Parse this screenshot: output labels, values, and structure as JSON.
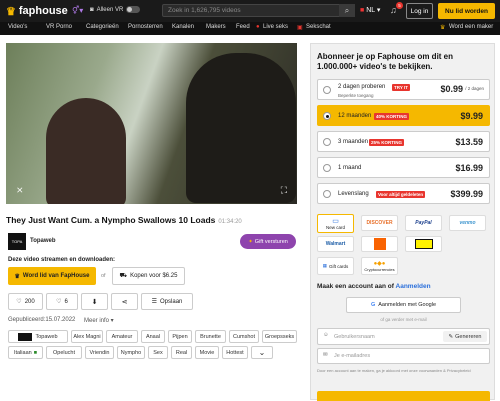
{
  "header": {
    "logo_text": "faphouse",
    "vr_toggle_label": "Alleen VR",
    "search_placeholder": "Zoek in 1,626,795 videos",
    "language": "NL",
    "notifications_count": "5",
    "login_label": "Log in",
    "join_label": "Nu lid worden"
  },
  "nav": {
    "items": [
      "Video's",
      "VR Porno",
      "Categorieën",
      "Pornosterren",
      "Kanalen",
      "Makers",
      "Feed",
      "Live seks",
      "Sekschat"
    ],
    "maker_label": "Word een maker"
  },
  "video": {
    "title": "They Just Want Cum. a Nympho Swallows 10 Loads",
    "duration": "01:34:20",
    "channel_name": "Topaweb",
    "gift_label": "Gift versturen",
    "stream_label": "Deze video streamen en downloaden:",
    "member_button": "Word lid van FapHouse",
    "or_label": "of",
    "buy_button": "Kopen voor $6.25",
    "likes": "200",
    "dislikes": "6",
    "save_label": "Opslaan",
    "published": "Gepubliceerd:15.07.2022",
    "more_info": "Meer info"
  },
  "tags": [
    "Topaweb",
    "Alex Magni",
    "Amateur",
    "Anaal",
    "Pijpen",
    "Brunette",
    "Cumshot",
    "Groepsseks",
    "Italiaan",
    "Opelucht",
    "Vriendin",
    "Nympho",
    "Sex",
    "Real",
    "Movie",
    "Hottest"
  ],
  "subscribe": {
    "heading": "Abonneer je op Faphouse om dit en 1.000.000+ video's te bekijken.",
    "plans": [
      {
        "label": "2 dagen proberen",
        "sub": "Beperkte toegang",
        "badge": "TRY IT",
        "price": "$0.99",
        "price_suffix": "/ 2 dagen"
      },
      {
        "label": "12 maanden",
        "sub": "",
        "badge": "40% KORTING",
        "price": "$9.99"
      },
      {
        "label": "3 maanden",
        "sub": "",
        "badge": "25% KORTING",
        "price": "$13.59"
      },
      {
        "label": "1 maand",
        "sub": "",
        "badge": "",
        "price": "$16.99"
      },
      {
        "label": "Levenslang",
        "sub": "",
        "badge": "Voor altijd geldeleten",
        "price": "$399.99"
      }
    ],
    "payments": [
      "New card",
      "DISCOVER",
      "PayPal",
      "venmo",
      "Walmart",
      "Home Depot",
      "Best Buy",
      "Gift cards",
      "Cryptocurrencies"
    ],
    "account_heading": "Maak een account aan of",
    "login_link": "Aanmelden",
    "google_button": "Aanmelden met Google",
    "or_email": "of ga verder met e-mail",
    "username_placeholder": "Gebruikersnaam",
    "generate_label": "Genereren",
    "email_placeholder": "Je e-mailadres",
    "terms": "Door een account aan te maken, ga je akkoord met onze voorwaarden & Privacybeleid"
  },
  "colors": {
    "accent": "#f5b800",
    "badge_red": "#e8352e",
    "gift_purple": "#8e44ad",
    "link_blue": "#2a6fdb"
  }
}
